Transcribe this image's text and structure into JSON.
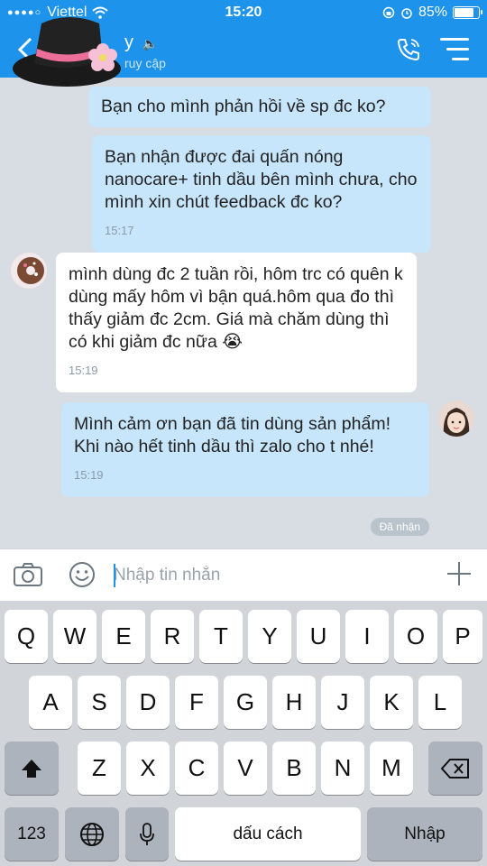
{
  "status_bar": {
    "carrier": "Viettel",
    "time": "15:20",
    "battery": "85%",
    "battery_level": 0.85
  },
  "header": {
    "back_icon": "chevron-left-icon",
    "contact_name": "y",
    "contact_status": "ruy cập",
    "call_icon": "phone-icon",
    "menu_icon": "menu-icon"
  },
  "messages": [
    {
      "direction": "sent",
      "text": "Bạn cho mình phản hồi về sp đc ko?",
      "time": ""
    },
    {
      "direction": "sent",
      "text": "Bạn nhận được đai quấn nóng nanocare+ tinh dầu bên mình chưa, cho mình xin chút feedback đc ko?",
      "time": "15:17"
    },
    {
      "direction": "received",
      "text": "mình dùng đc 2 tuần rồi, hôm trc có quên k dùng mấy hôm vì bận quá.hôm qua đo thì thấy giảm đc 2cm. Giá mà chăm dùng thì có khi giảm đc nữa",
      "emoji": "😭",
      "time": "15:19"
    },
    {
      "direction": "sent",
      "text": "Mình cảm ơn bạn đã tin dùng sản phẩm! Khi nào hết tinh dầu thì zalo cho t nhé!",
      "time": "15:19"
    }
  ],
  "read_status": "Đã nhận",
  "composer": {
    "placeholder": "Nhập tin nhắn"
  },
  "keyboard": {
    "row1": [
      "Q",
      "W",
      "E",
      "R",
      "T",
      "Y",
      "U",
      "I",
      "O",
      "P"
    ],
    "row2": [
      "A",
      "S",
      "D",
      "F",
      "G",
      "H",
      "J",
      "K",
      "L"
    ],
    "row3": [
      "Z",
      "X",
      "C",
      "V",
      "B",
      "N",
      "M"
    ],
    "numbers_label": "123",
    "space_label": "dấu cách",
    "return_label": "Nhập"
  }
}
